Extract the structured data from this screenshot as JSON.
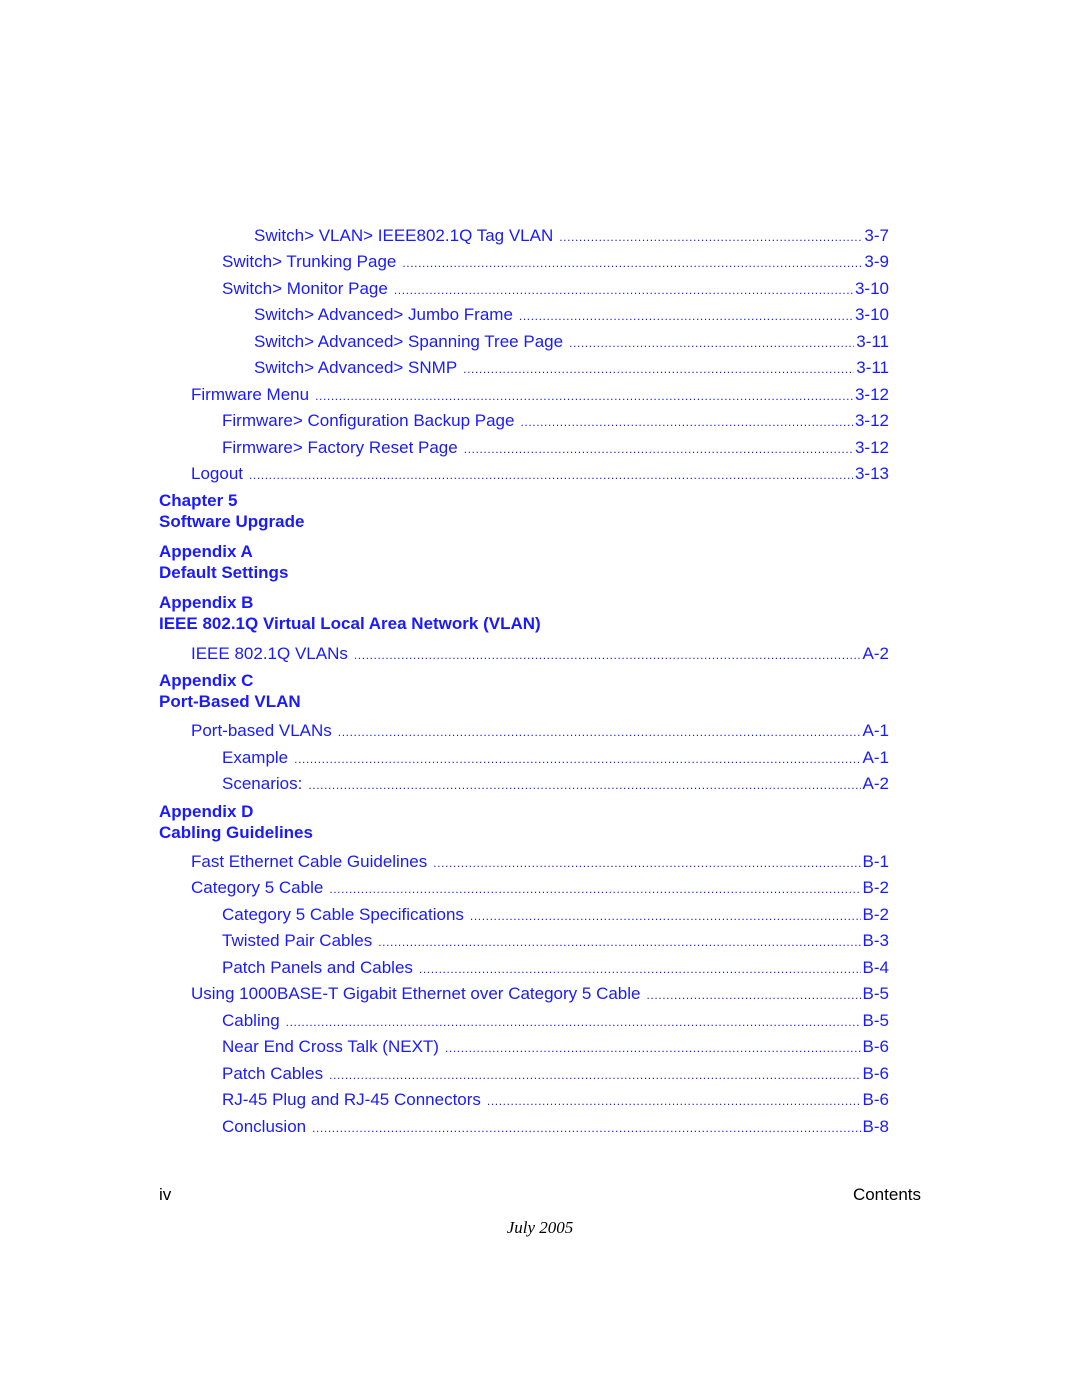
{
  "toc": {
    "entries": [
      {
        "level": 3,
        "title": "Switch> VLAN> IEEE802.1Q Tag VLAN",
        "page": "3-7"
      },
      {
        "level": 2,
        "title": "Switch> Trunking Page",
        "page": "3-9"
      },
      {
        "level": 2,
        "title": "Switch> Monitor Page",
        "page": "3-10"
      },
      {
        "level": 3,
        "title": "Switch> Advanced> Jumbo Frame",
        "page": "3-10"
      },
      {
        "level": 3,
        "title": "Switch> Advanced> Spanning Tree Page",
        "page": "3-11"
      },
      {
        "level": 3,
        "title": "Switch> Advanced> SNMP",
        "page": "3-11"
      },
      {
        "level": 1,
        "title": "Firmware Menu",
        "page": "3-12"
      },
      {
        "level": 2,
        "title": "Firmware> Configuration Backup Page",
        "page": "3-12"
      },
      {
        "level": 2,
        "title": "Firmware> Factory Reset Page",
        "page": "3-12"
      },
      {
        "level": 1,
        "title": "Logout",
        "page": "3-13"
      }
    ],
    "chapter5": {
      "label": "Chapter 5",
      "title": "Software Upgrade"
    },
    "appendixA": {
      "label": "Appendix A",
      "title": "Default Settings"
    },
    "appendixB": {
      "label": "Appendix B",
      "title": "IEEE 802.1Q Virtual Local Area Network (VLAN)",
      "entries": [
        {
          "level": 1,
          "title": "IEEE 802.1Q VLANs",
          "page": "A-2"
        }
      ]
    },
    "appendixC": {
      "label": "Appendix C",
      "title": "Port-Based VLAN",
      "entries": [
        {
          "level": 1,
          "title": "Port-based VLANs",
          "page": "A-1"
        },
        {
          "level": 2,
          "title": "Example",
          "page": "A-1"
        },
        {
          "level": 2,
          "title": "Scenarios:",
          "page": "A-2"
        }
      ]
    },
    "appendixD": {
      "label": "Appendix D",
      "title": "Cabling Guidelines",
      "entries": [
        {
          "level": 1,
          "title": "Fast Ethernet Cable Guidelines",
          "page": "B-1"
        },
        {
          "level": 1,
          "title": "Category 5 Cable",
          "page": "B-2"
        },
        {
          "level": 2,
          "title": "Category 5 Cable Specifications",
          "page": "B-2"
        },
        {
          "level": 2,
          "title": "Twisted Pair Cables",
          "page": "B-3"
        },
        {
          "level": 2,
          "title": "Patch Panels and Cables",
          "page": "B-4"
        },
        {
          "level": 1,
          "title": "Using 1000BASE-T Gigabit Ethernet over Category 5 Cable",
          "page": "B-5"
        },
        {
          "level": 2,
          "title": "Cabling",
          "page": "B-5"
        },
        {
          "level": 2,
          "title": "Near End Cross Talk (NEXT)",
          "page": "B-6"
        },
        {
          "level": 2,
          "title": "Patch Cables",
          "page": "B-6"
        },
        {
          "level": 2,
          "title": "RJ-45 Plug and RJ-45 Connectors",
          "page": "B-6"
        },
        {
          "level": 2,
          "title": "Conclusion",
          "page": "B-8"
        }
      ]
    }
  },
  "footer": {
    "page_number": "iv",
    "section": "Contents",
    "date": "July 2005"
  },
  "colors": {
    "link": "#1a1aff",
    "text": "#000000"
  }
}
